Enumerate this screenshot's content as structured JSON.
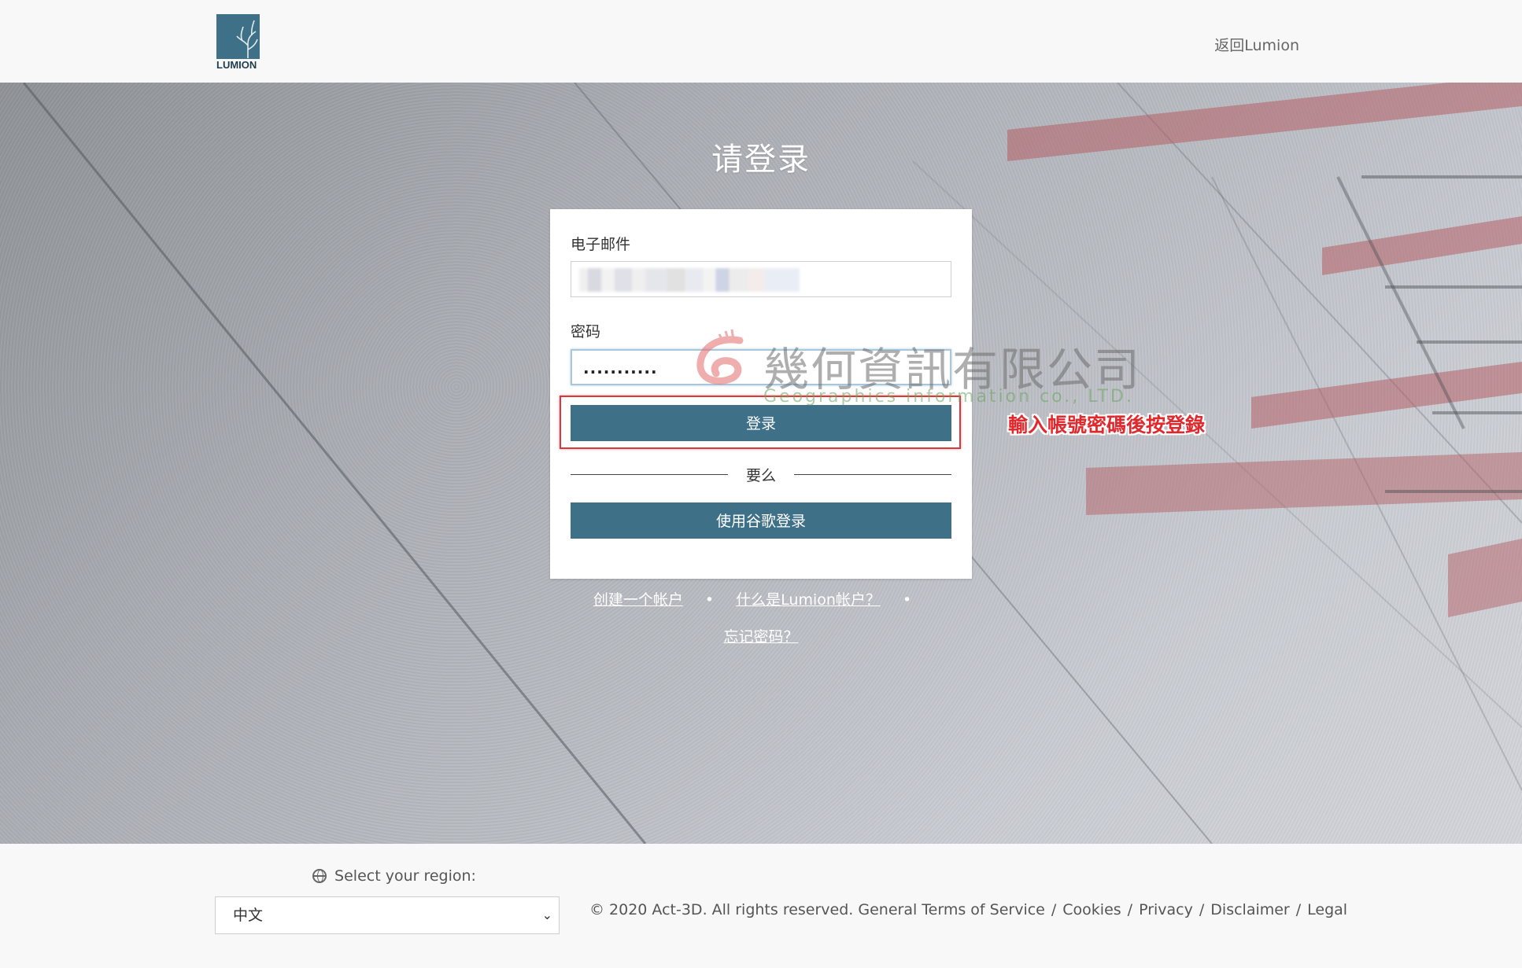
{
  "header": {
    "logo_text": "LUMION",
    "back_link": "返回Lumion"
  },
  "login": {
    "title": "请登录",
    "email_label": "电子邮件",
    "email_value": "",
    "password_label": "密码",
    "password_value": "...........",
    "login_button": "登录",
    "or_text": "要么",
    "google_button": "使用谷歌登录"
  },
  "links": {
    "create_account": "创建一个帐户",
    "what_is_account": "什么是Lumion帐户？",
    "forgot_password": "忘记密码？",
    "separator": "•"
  },
  "annotation": {
    "note": "輸入帳號密碼後按登錄",
    "color": "#e0282d"
  },
  "watermark": {
    "company_name": "幾何資訊有限公司",
    "english_name": "Geographics information co., LTD."
  },
  "footer": {
    "region_label": "Select your region:",
    "region_value": "中文",
    "copyright": "© 2020 Act-3D. All rights reserved.",
    "legal_links": [
      "General Terms of Service",
      "Cookies",
      "Privacy",
      "Disclaimer",
      "Legal"
    ]
  },
  "colors": {
    "brand": "#3e7088",
    "annotation": "#d9393c"
  }
}
